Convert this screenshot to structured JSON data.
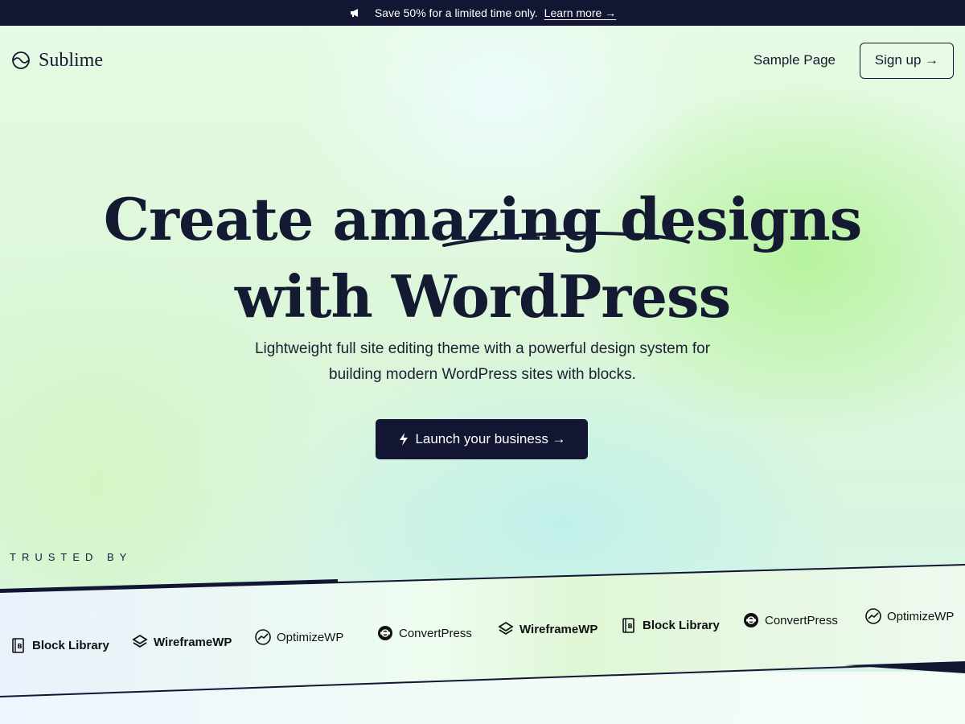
{
  "announcement": {
    "text": "Save 50% for a limited time only.",
    "link": "Learn more →"
  },
  "header": {
    "brand": "Sublime",
    "nav_link": "Sample Page",
    "signup": "Sign up →"
  },
  "hero": {
    "title_line1": "Create amazing designs",
    "title_line2": "with WordPress",
    "subtitle_line1": "Lightweight full site editing theme with a powerful design system for",
    "subtitle_line2": "building modern WordPress sites with blocks.",
    "cta": "Launch your business →"
  },
  "trusted": {
    "label": "TRUSTED BY",
    "logos": [
      {
        "name": "Block Library",
        "icon": "book-icon"
      },
      {
        "name": "WireframeWP",
        "icon": "layers-icon"
      },
      {
        "name": "OptimizeWP",
        "icon": "trend-icon"
      },
      {
        "name": "ConvertPress",
        "icon": "convert-icon"
      },
      {
        "name": "WireframeWP",
        "icon": "layers-icon"
      },
      {
        "name": "Block Library",
        "icon": "book-icon"
      },
      {
        "name": "ConvertPress",
        "icon": "convert-icon"
      },
      {
        "name": "OptimizeWP",
        "icon": "trend-icon"
      }
    ]
  },
  "colors": {
    "navy": "#121632",
    "text": "#151a33"
  }
}
